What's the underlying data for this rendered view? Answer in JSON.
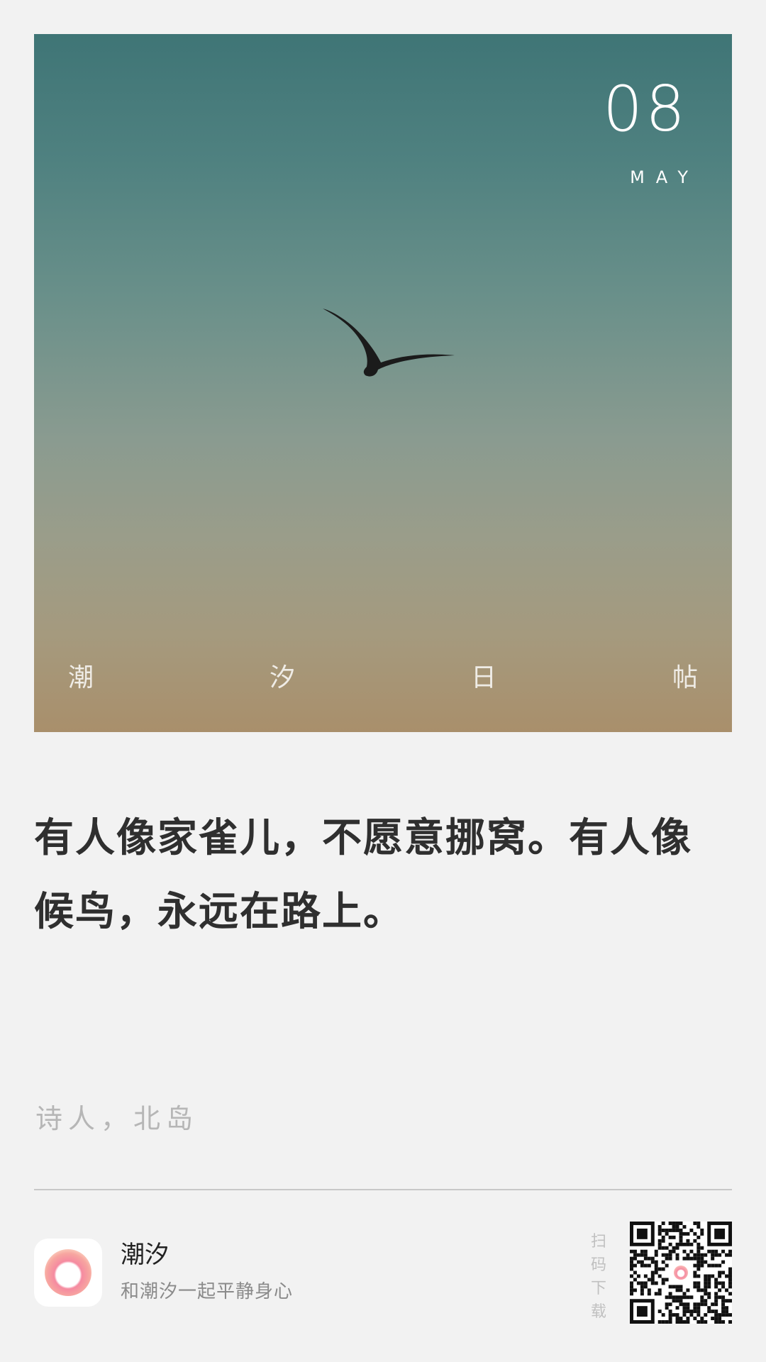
{
  "poster": {
    "day": "08",
    "month": "MAY",
    "brand_chars": [
      "潮",
      "汐",
      "日",
      "帖"
    ],
    "image": "bird-silhouette-sky"
  },
  "quote": {
    "text": "有人像家雀儿，不愿意挪窝。有人像候鸟，永远在路上。"
  },
  "author": {
    "text": "诗人，北岛"
  },
  "footer": {
    "app_name": "潮汐",
    "slogan": "和潮汐一起平静身心",
    "scan_label": "扫码下载",
    "icon": "app-logo-icon",
    "qr": "qr-code"
  },
  "colors": {
    "background": "#f2f2f2",
    "sky_top": "#3f7576",
    "sky_bottom": "#a98f6b",
    "text": "#2f2f2f",
    "muted": "#b6b6b6"
  }
}
